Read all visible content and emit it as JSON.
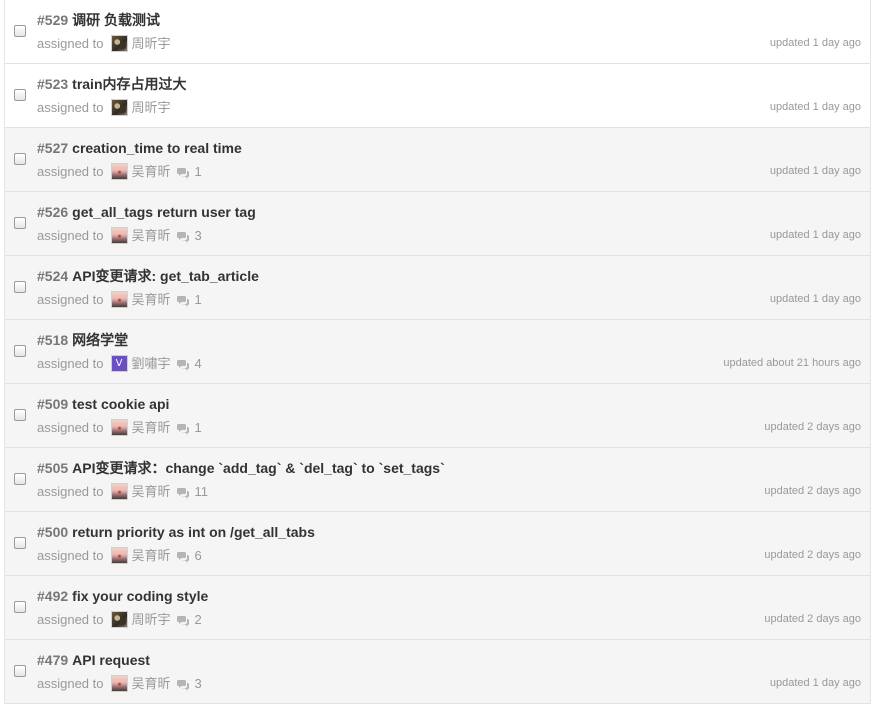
{
  "assigned_label": "assigned to",
  "issues": [
    {
      "number": "#529",
      "title": "调研 负载测试",
      "assignee": "周昕宇",
      "avatar": "zhou",
      "comments": "",
      "updated": "updated 1 day ago",
      "unread": true
    },
    {
      "number": "#523",
      "title": "train内存占用过大",
      "assignee": "周昕宇",
      "avatar": "zhou",
      "comments": "",
      "updated": "updated 1 day ago",
      "unread": true
    },
    {
      "number": "#527",
      "title": "creation_time to real time",
      "assignee": "吴育昕",
      "avatar": "wu",
      "comments": "1",
      "updated": "updated 1 day ago",
      "unread": false
    },
    {
      "number": "#526",
      "title": "get_all_tags return user tag",
      "assignee": "吴育昕",
      "avatar": "wu",
      "comments": "3",
      "updated": "updated 1 day ago",
      "unread": false
    },
    {
      "number": "#524",
      "title": "API变更请求: get_tab_article",
      "assignee": "吴育昕",
      "avatar": "wu",
      "comments": "1",
      "updated": "updated 1 day ago",
      "unread": false
    },
    {
      "number": "#518",
      "title": "网络学堂",
      "assignee": "劉嘯宇",
      "avatar": "liu",
      "avatar_letter": "V",
      "comments": "4",
      "updated": "updated about 21 hours ago",
      "unread": false
    },
    {
      "number": "#509",
      "title": "test cookie api",
      "assignee": "吴育昕",
      "avatar": "wu",
      "comments": "1",
      "updated": "updated 2 days ago",
      "unread": false
    },
    {
      "number": "#505",
      "title": "API变更请求：change `add_tag` & `del_tag` to `set_tags`",
      "assignee": "吴育昕",
      "avatar": "wu",
      "comments": "11",
      "updated": "updated 2 days ago",
      "unread": false
    },
    {
      "number": "#500",
      "title": "return priority as int on /get_all_tabs",
      "assignee": "吴育昕",
      "avatar": "wu",
      "comments": "6",
      "updated": "updated 2 days ago",
      "unread": false
    },
    {
      "number": "#492",
      "title": "fix your coding style",
      "assignee": "周昕宇",
      "avatar": "zhou",
      "comments": "2",
      "updated": "updated 2 days ago",
      "unread": false
    },
    {
      "number": "#479",
      "title": "API request",
      "assignee": "吴育昕",
      "avatar": "wu",
      "comments": "3",
      "updated": "updated 1 day ago",
      "unread": false
    }
  ],
  "icons": {
    "checkbox": "checkbox-icon",
    "comment": "speech-bubble-icon"
  },
  "colors": {
    "number": "#777777",
    "title": "#333333",
    "meta": "#999999",
    "row_read": "#f5f5f5",
    "row_unread": "#ffffff",
    "avatar_v": "#6a4fc9"
  }
}
